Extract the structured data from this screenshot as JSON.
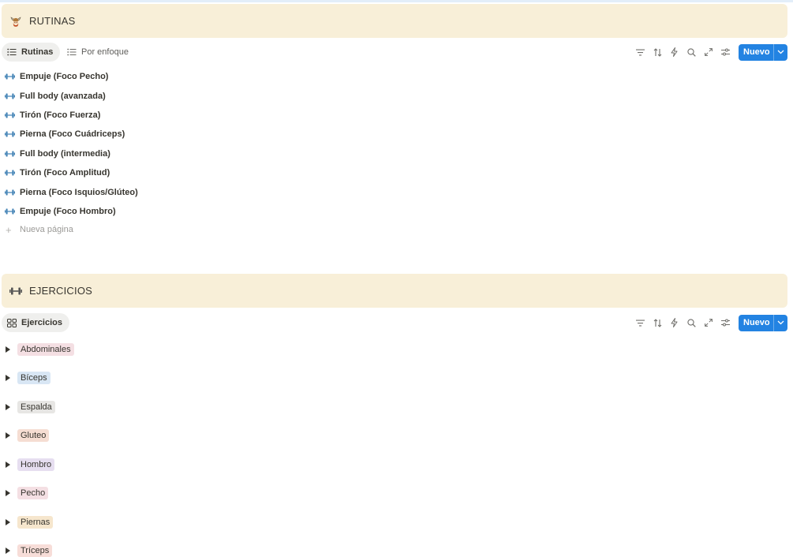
{
  "rutinas": {
    "title": "RUTINAS",
    "views": [
      {
        "label": "Rutinas",
        "active": true,
        "icon": "list-icon"
      },
      {
        "label": "Por enfoque",
        "active": false,
        "icon": "list-icon"
      }
    ],
    "new_button": "Nuevo",
    "items": [
      "Empuje (Foco Pecho)",
      "Full body (avanzada)",
      "Tirón (Foco Fuerza)",
      "Pierna (Foco Cuádriceps)",
      "Full body (intermedia)",
      "Tirón (Foco Amplitud)",
      "Pierna (Foco Isquios/Glúteo)",
      "Empuje (Foco Hombro)"
    ],
    "new_page": "Nueva página"
  },
  "ejercicios": {
    "title": "EJERCICIOS",
    "views": [
      {
        "label": "Ejercicios",
        "active": true,
        "icon": "board-icon"
      }
    ],
    "new_button": "Nuevo",
    "groups": [
      {
        "label": "Abdominales",
        "color": "#f4dfe3"
      },
      {
        "label": "Bíceps",
        "color": "#d8e6f4"
      },
      {
        "label": "Espalda",
        "color": "#e7e6e4"
      },
      {
        "label": "Gluteo",
        "color": "#f5ddd2"
      },
      {
        "label": "Hombro",
        "color": "#e6def0"
      },
      {
        "label": "Pecho",
        "color": "#f4dfe3"
      },
      {
        "label": "Piernas",
        "color": "#f6e6cd"
      },
      {
        "label": "Tríceps",
        "color": "#f7ddd8"
      }
    ]
  },
  "colors": {
    "header_bg": "#f8efd8",
    "accent": "#2383e2",
    "dumbbell": "#3d7fb3"
  }
}
